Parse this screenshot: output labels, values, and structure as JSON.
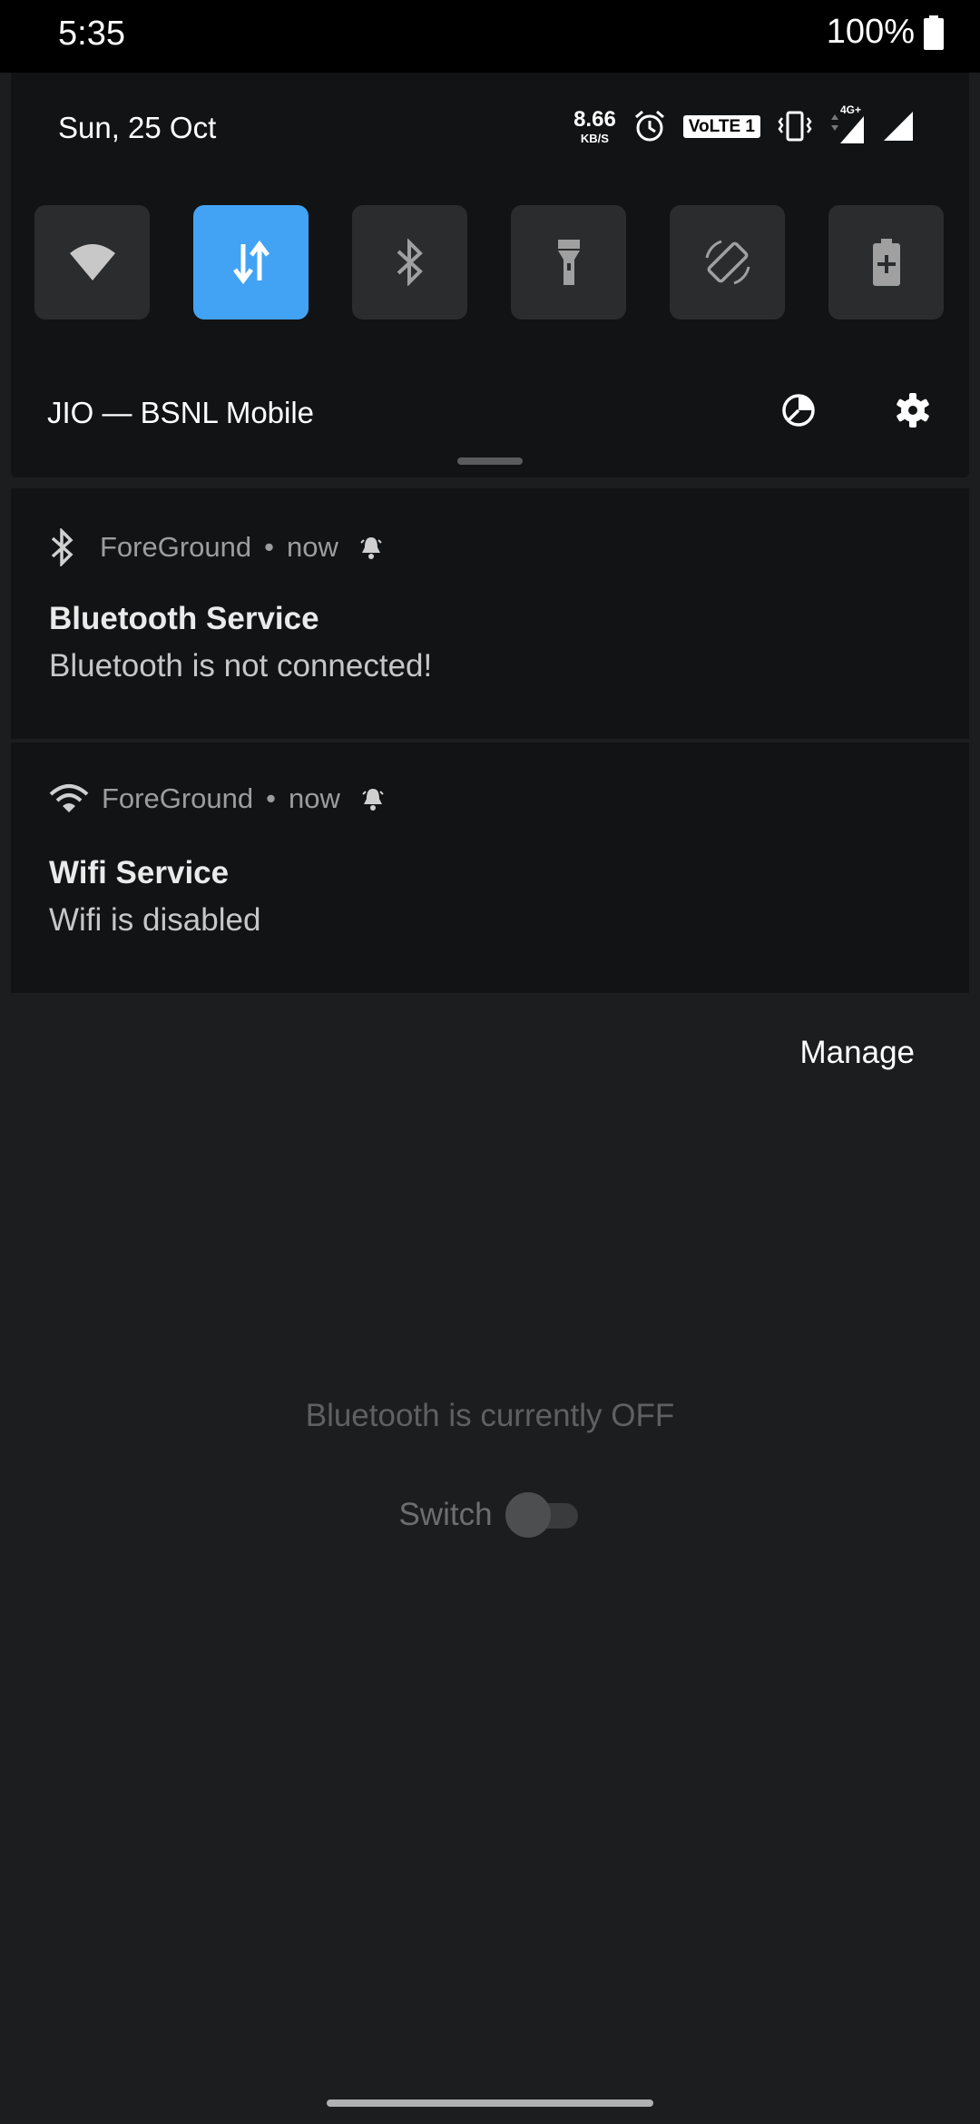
{
  "status_bar": {
    "time": "5:35",
    "battery": "100%"
  },
  "quick_settings": {
    "date": "Sun, 25 Oct",
    "net_speed_value": "8.66",
    "net_speed_unit": "KB/S",
    "volte": "VoLTE 1",
    "network_type": "4G+",
    "operator": "JIO — BSNL Mobile",
    "tiles": [
      {
        "icon": "wifi-icon",
        "active": false
      },
      {
        "icon": "mobile-data-icon",
        "active": true
      },
      {
        "icon": "bluetooth-icon",
        "active": false
      },
      {
        "icon": "flashlight-icon",
        "active": false
      },
      {
        "icon": "auto-rotate-icon",
        "active": false
      },
      {
        "icon": "battery-saver-icon",
        "active": false
      }
    ],
    "accent": "#42a3f5"
  },
  "notifications": [
    {
      "icon": "bluetooth-icon",
      "app": "ForeGround",
      "time": "now",
      "title": "Bluetooth Service",
      "body": "Bluetooth is not connected!"
    },
    {
      "icon": "wifi-icon",
      "app": "ForeGround",
      "time": "now",
      "title": "Wifi Service",
      "body": "Wifi is disabled"
    }
  ],
  "manage_label": "Manage",
  "app": {
    "bluetooth_status": "Bluetooth is currently OFF",
    "switch_label": "Switch",
    "switch_on": false
  }
}
